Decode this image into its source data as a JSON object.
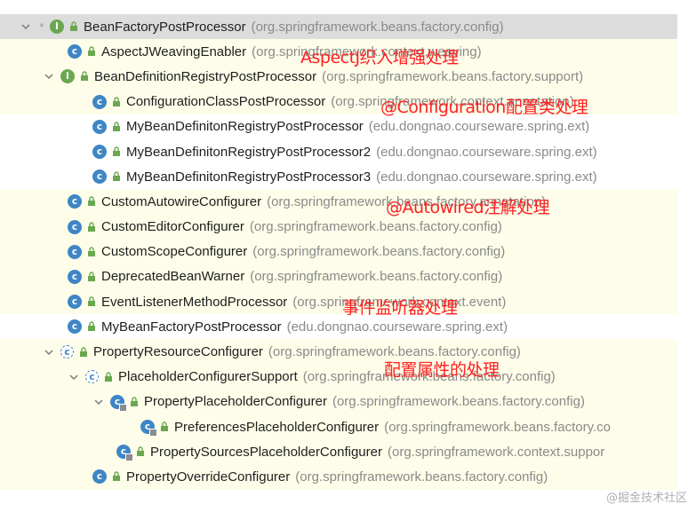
{
  "tree": {
    "rows": [
      {
        "name": "BeanFactoryPostProcessor",
        "pkg": "(org.springframework.beans.factory.config)",
        "icon": "interface",
        "star": "*",
        "arrow": "expanded"
      },
      {
        "name": "AspectJWeavingEnabler",
        "pkg": "(org.springframework.context.weaving)",
        "icon": "class",
        "arrow": "none"
      },
      {
        "name": "BeanDefinitionRegistryPostProcessor",
        "pkg": "(org.springframework.beans.factory.support)",
        "icon": "interface",
        "arrow": "expanded"
      },
      {
        "name": "ConfigurationClassPostProcessor",
        "pkg": "(org.springframework.context.annotation)",
        "icon": "class",
        "arrow": "none"
      },
      {
        "name": "MyBeanDefinitonRegistryPostProcessor",
        "pkg": "(edu.dongnao.courseware.spring.ext)",
        "icon": "class",
        "arrow": "none"
      },
      {
        "name": "MyBeanDefinitonRegistryPostProcessor2",
        "pkg": "(edu.dongnao.courseware.spring.ext)",
        "icon": "class",
        "arrow": "none"
      },
      {
        "name": "MyBeanDefinitonRegistryPostProcessor3",
        "pkg": "(edu.dongnao.courseware.spring.ext)",
        "icon": "class",
        "arrow": "none"
      },
      {
        "name": "CustomAutowireConfigurer",
        "pkg": "(org.springframework.beans.factory.annotation)",
        "icon": "class",
        "arrow": "none"
      },
      {
        "name": "CustomEditorConfigurer",
        "pkg": "(org.springframework.beans.factory.config)",
        "icon": "class",
        "arrow": "none"
      },
      {
        "name": "CustomScopeConfigurer",
        "pkg": "(org.springframework.beans.factory.config)",
        "icon": "class",
        "arrow": "none"
      },
      {
        "name": "DeprecatedBeanWarner",
        "pkg": "(org.springframework.beans.factory.config)",
        "icon": "class",
        "arrow": "none"
      },
      {
        "name": "EventListenerMethodProcessor",
        "pkg": "(org.springframework.context.event)",
        "icon": "class",
        "arrow": "none"
      },
      {
        "name": "MyBeanFactoryPostProcessor",
        "pkg": "(edu.dongnao.courseware.spring.ext)",
        "icon": "class",
        "arrow": "none"
      },
      {
        "name": "PropertyResourceConfigurer",
        "pkg": "(org.springframework.beans.factory.config)",
        "icon": "abstract",
        "arrow": "expanded"
      },
      {
        "name": "PlaceholderConfigurerSupport",
        "pkg": "(org.springframework.beans.factory.config)",
        "icon": "abstract",
        "arrow": "expanded"
      },
      {
        "name": "PropertyPlaceholderConfigurer",
        "pkg": "(org.springframework.beans.factory.config)",
        "icon": "class",
        "arrow": "expanded"
      },
      {
        "name": "PreferencesPlaceholderConfigurer",
        "pkg": "(org.springframework.beans.factory.co",
        "icon": "class",
        "arrow": "none"
      },
      {
        "name": "PropertySourcesPlaceholderConfigurer",
        "pkg": "(org.springframework.context.suppor",
        "icon": "class",
        "arrow": "none"
      },
      {
        "name": "PropertyOverrideConfigurer",
        "pkg": "(org.springframework.beans.factory.config)",
        "icon": "class",
        "arrow": "none"
      }
    ]
  },
  "annotations": {
    "aspectj": "AspectJ织入增强处理",
    "configuration": "@Configuration配置类处理",
    "autowired": "@Autowired注解处理",
    "event": "事件监听器处理",
    "property": "配置属性的处理"
  },
  "watermark": "@掘金技术社区",
  "colors": {
    "interface_icon": "#6aa84f",
    "class_icon": "#3e86c5",
    "annotation_text": "#ff2222",
    "package_text": "#8a8a8a",
    "selected_row": "#dcdcdc",
    "highlight_row": "#fdfde9"
  }
}
